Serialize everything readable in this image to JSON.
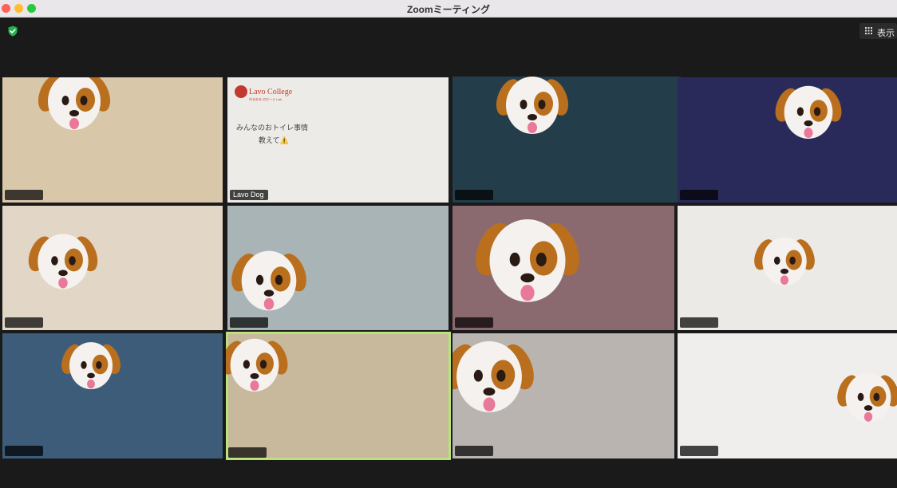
{
  "window": {
    "title": "Zoomミーティング"
  },
  "toolbar": {
    "view_label": "表示",
    "view_icon": "grid-icon"
  },
  "security_icon": "shield-check-icon",
  "participants": [
    {
      "name": "",
      "bg": "#d8c7a8"
    },
    {
      "name": "Lavo Dog",
      "bg": "#ecebe7"
    },
    {
      "name": "",
      "bg": "#233e4a"
    },
    {
      "name": "",
      "bg": "#2a2a5a"
    },
    {
      "name": "",
      "bg": "#e2d6c6"
    },
    {
      "name": "",
      "bg": "#a8b4b6"
    },
    {
      "name": "",
      "bg": "#8b6a6f"
    },
    {
      "name": "",
      "bg": "#eceae7"
    },
    {
      "name": "",
      "bg": "#3c5c7a"
    },
    {
      "name": "",
      "bg": "#c8b89c",
      "active": true
    },
    {
      "name": "",
      "bg": "#b9b4b0"
    },
    {
      "name": "",
      "bg": "#efeeed"
    }
  ],
  "slide": {
    "brand": "Lavo College",
    "sub": "ゆるめる のだーぐ Lab",
    "headline_1": "みんなのおトイレ事情",
    "headline_2": "教えて⚠️"
  }
}
